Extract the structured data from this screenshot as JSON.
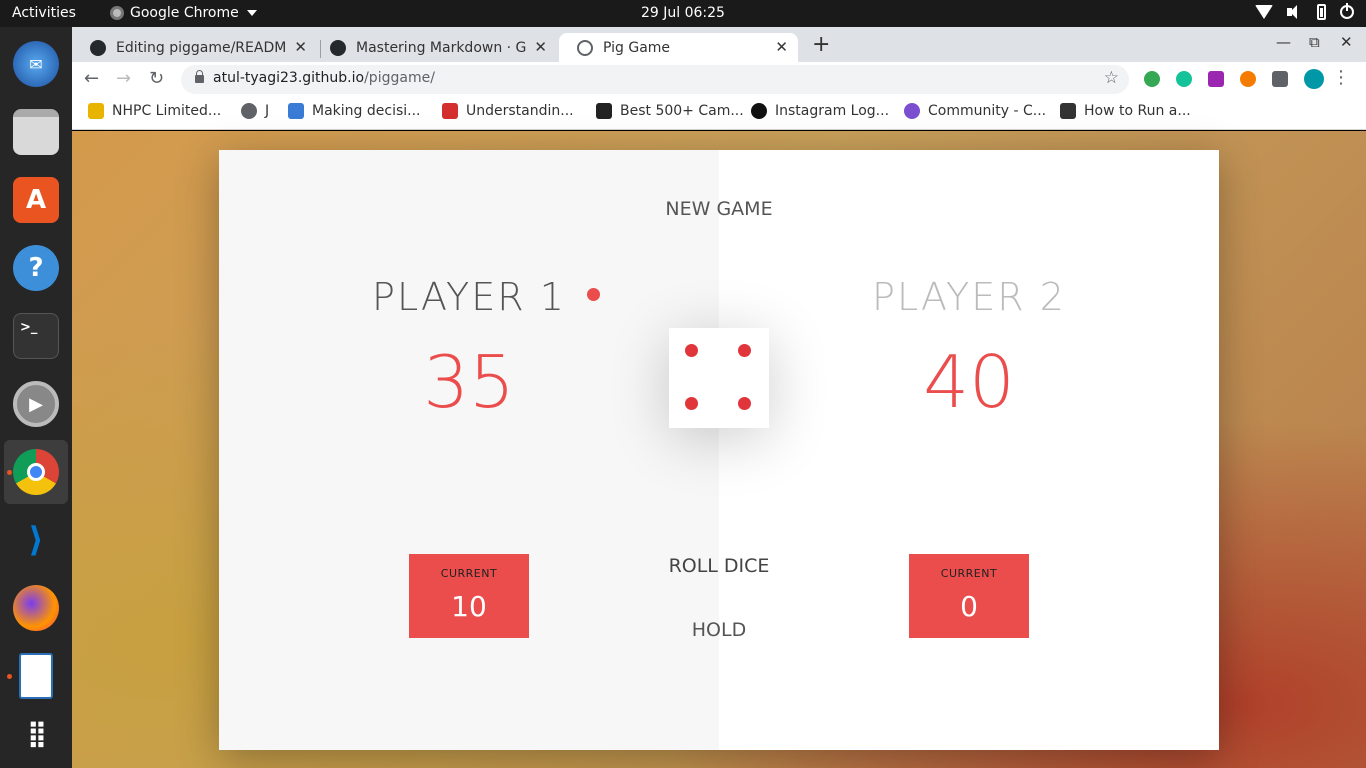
{
  "topbar": {
    "activities": "Activities",
    "app_name": "Google Chrome",
    "clock": "29 Jul  06:25"
  },
  "dock": {
    "apps": [
      "thunderbird-icon",
      "files-icon",
      "app-store-icon",
      "help-icon",
      "terminal-icon",
      "settings-icon",
      "chrome-icon",
      "vscode-icon",
      "firefox-icon",
      "writer-icon",
      "app-grid-icon"
    ]
  },
  "browser": {
    "tabs": [
      {
        "title": "Editing piggame/README.md",
        "active": false
      },
      {
        "title": "Mastering Markdown · GitHub",
        "active": false
      },
      {
        "title": "Pig Game",
        "active": true
      }
    ],
    "url_host": "atul-tyagi23.github.io",
    "url_path": "/piggame/",
    "bookmarks": [
      "NHPC Limited...",
      "J",
      "Making decisi...",
      "Understandin...",
      "Best 500+ Cam...",
      "Instagram Log...",
      "Community - C...",
      "How to Run a..."
    ]
  },
  "game": {
    "new_game": "NEW GAME",
    "roll_dice": "ROLL DICE",
    "hold": "HOLD",
    "dice_value": 4,
    "player1": {
      "name": "PLAYER 1",
      "score": "35",
      "current_label": "CURRENT",
      "current": "10",
      "active": true
    },
    "player2": {
      "name": "PLAYER 2",
      "score": "40",
      "current_label": "CURRENT",
      "current": "0",
      "active": false
    },
    "accent_color": "#eb4d4d"
  }
}
